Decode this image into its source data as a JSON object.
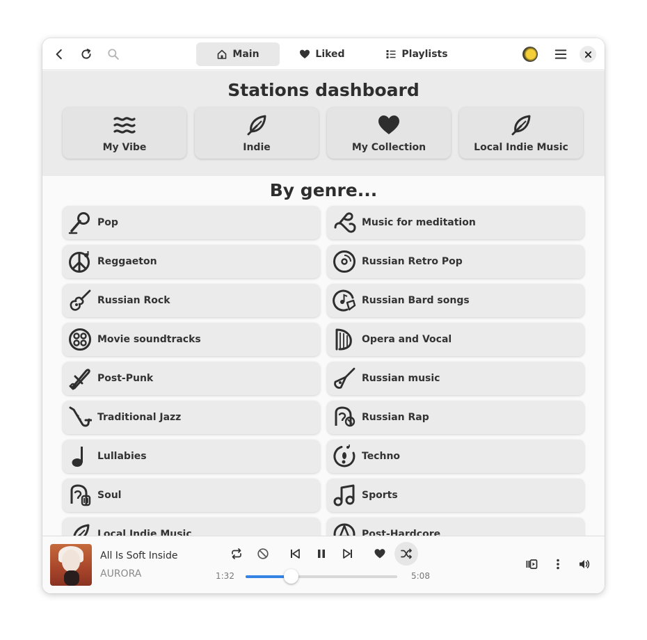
{
  "header": {
    "tabs": [
      {
        "label": "Main",
        "icon": "home-icon",
        "active": true
      },
      {
        "label": "Liked",
        "icon": "heart-icon",
        "active": false
      },
      {
        "label": "Playlists",
        "icon": "list-icon",
        "active": false
      }
    ]
  },
  "dashboard": {
    "title": "Stations dashboard",
    "stations": [
      {
        "label": "My Vibe",
        "icon": "waves-icon"
      },
      {
        "label": "Indie",
        "icon": "feather-icon"
      },
      {
        "label": "My Collection",
        "icon": "heart-icon"
      },
      {
        "label": "Local Indie Music",
        "icon": "feather-icon"
      }
    ]
  },
  "genres": {
    "title": "By genre...",
    "left": [
      {
        "label": "Pop",
        "icon": "microphone-icon"
      },
      {
        "label": "Reggaeton",
        "icon": "peace-note-icon"
      },
      {
        "label": "Russian Rock",
        "icon": "guitar-icon"
      },
      {
        "label": "Movie soundtracks",
        "icon": "film-reel-icon"
      },
      {
        "label": "Post-Punk",
        "icon": "safety-pin-icon"
      },
      {
        "label": "Traditional Jazz",
        "icon": "saxophone-icon"
      },
      {
        "label": "Lullabies",
        "icon": "music-note-icon"
      },
      {
        "label": "Soul",
        "icon": "soul-face-icon"
      },
      {
        "label": "Local Indie Music",
        "icon": "feather-icon"
      }
    ],
    "right": [
      {
        "label": "Music for meditation",
        "icon": "lotus-icon"
      },
      {
        "label": "Russian Retro Pop",
        "icon": "vinyl-icon"
      },
      {
        "label": "Russian Bard songs",
        "icon": "disc-note-icon"
      },
      {
        "label": "Opera and Vocal",
        "icon": "harp-icon"
      },
      {
        "label": "Russian music",
        "icon": "balalaika-icon"
      },
      {
        "label": "Russian Rap",
        "icon": "rap-face-icon"
      },
      {
        "label": "Techno",
        "icon": "footprint-disc-icon"
      },
      {
        "label": "Sports",
        "icon": "music-notes-icon"
      },
      {
        "label": "Post-Hardcore",
        "icon": "anarchy-icon"
      }
    ]
  },
  "player": {
    "title": "All Is Soft Inside",
    "artist": "AURORA",
    "elapsed": "1:32",
    "duration": "5:08",
    "progress_fraction": 0.3,
    "accent_color": "#3584e4"
  }
}
